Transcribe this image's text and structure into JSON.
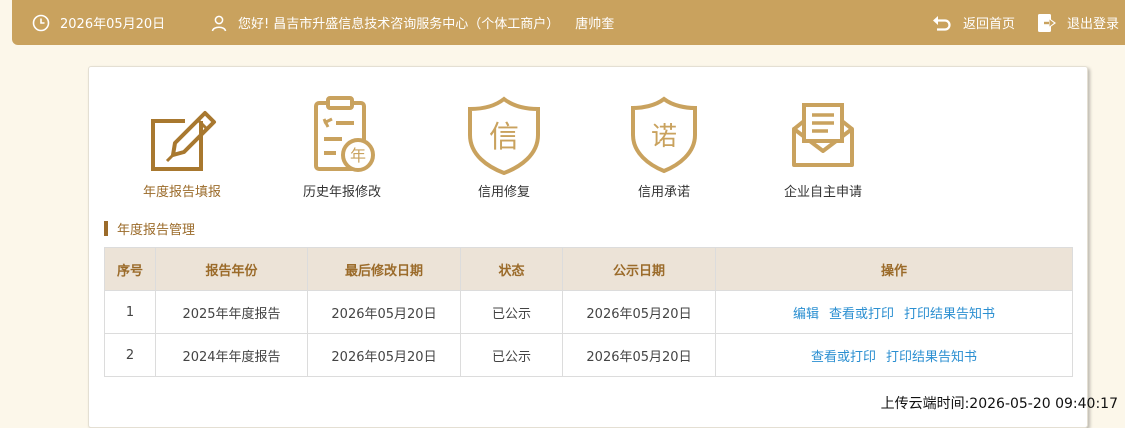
{
  "header": {
    "date": "2026年05月20日",
    "greeting": "您好!",
    "company": "昌吉市升盛信息技术咨询服务中心（个体工商户）",
    "user": "唐帅奎",
    "back_home": "返回首页",
    "logout": "退出登录"
  },
  "menu": [
    {
      "label": "年度报告填报",
      "icon": "edit-report-icon",
      "text": ""
    },
    {
      "label": "历史年报修改",
      "icon": "clipboard-year-icon",
      "text": "年"
    },
    {
      "label": "信用修复",
      "icon": "shield-credit-icon",
      "text": "信"
    },
    {
      "label": "信用承诺",
      "icon": "shield-promise-icon",
      "text": "诺"
    },
    {
      "label": "企业自主申请",
      "icon": "envelope-icon",
      "text": ""
    }
  ],
  "section_title": "年度报告管理",
  "table": {
    "headers": [
      "序号",
      "报告年份",
      "最后修改日期",
      "状态",
      "公示日期",
      "操作"
    ],
    "rows": [
      {
        "no": "1",
        "year": "2025年年度报告",
        "modified": "2026年05月20日",
        "status": "已公示",
        "public_date": "2026年05月20日",
        "ops": [
          "编辑",
          "查看或打印",
          "打印结果告知书"
        ]
      },
      {
        "no": "2",
        "year": "2024年年度报告",
        "modified": "2026年05月20日",
        "status": "已公示",
        "public_date": "2026年05月20日",
        "ops": [
          "查看或打印",
          "打印结果告知书"
        ]
      }
    ]
  },
  "upload_time": "上传云端时间:2026-05-20 09:40:17",
  "colors": {
    "header_bg": "#c9a25e",
    "accent": "#9b6b2a",
    "link": "#2b8fd1",
    "page_bg": "#fcf7ea"
  }
}
